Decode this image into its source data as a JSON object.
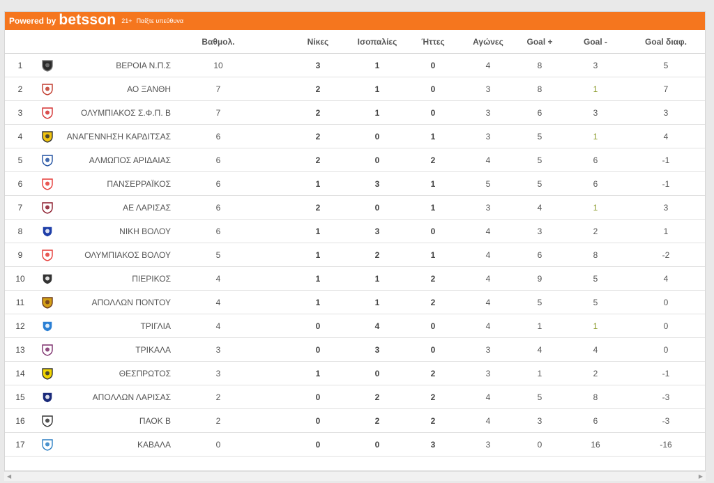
{
  "banner": {
    "powered_by": "Powered by",
    "brand": "betsson",
    "age": "21+",
    "responsible": "Παίξτε υπεύθυνα"
  },
  "colors": {
    "banner": "#f5761e",
    "goal_against_highlight": "#8a9a2a"
  },
  "columns": [
    "Βαθμολ.",
    "Νίκες",
    "Ισοπαλίες",
    "Ήττες",
    "Αγώνες",
    "Goal +",
    "Goal -",
    "Goal διαφ."
  ],
  "rows": [
    {
      "rank": "1",
      "crest": "veroia-crest-icon",
      "team": "ΒΕΡΟΙΑ Ν.Π.Σ",
      "pts": "10",
      "w": "3",
      "d": "1",
      "l": "0",
      "gp": "4",
      "gf": "8",
      "ga": "3",
      "gd": "5",
      "ga_hl": false
    },
    {
      "rank": "2",
      "crest": "xanthi-crest-icon",
      "team": "ΑΟ ΞΑΝΘΗ",
      "pts": "7",
      "w": "2",
      "d": "1",
      "l": "0",
      "gp": "3",
      "gf": "8",
      "ga": "1",
      "gd": "7",
      "ga_hl": true
    },
    {
      "rank": "3",
      "crest": "olympiacos-crest-icon",
      "team": "ΟΛΥΜΠΙΑΚΟΣ Σ.Φ.Π. Β",
      "pts": "7",
      "w": "2",
      "d": "1",
      "l": "0",
      "gp": "3",
      "gf": "6",
      "ga": "3",
      "gd": "3",
      "ga_hl": false
    },
    {
      "rank": "4",
      "crest": "anagennisi-crest-icon",
      "team": "ΑΝΑΓΕΝΝΗΣΗ ΚΑΡΔΙΤΣΑΣ",
      "pts": "6",
      "w": "2",
      "d": "0",
      "l": "1",
      "gp": "3",
      "gf": "5",
      "ga": "1",
      "gd": "4",
      "ga_hl": true
    },
    {
      "rank": "5",
      "crest": "almopos-crest-icon",
      "team": "ΑΛΜΩΠΟΣ ΑΡΙΔΑΙΑΣ",
      "pts": "6",
      "w": "2",
      "d": "0",
      "l": "2",
      "gp": "4",
      "gf": "5",
      "ga": "6",
      "gd": "-1",
      "ga_hl": false
    },
    {
      "rank": "6",
      "crest": "panserraikos-crest-icon",
      "team": "ΠΑΝΣΕΡΡΑΪΚΟΣ",
      "pts": "6",
      "w": "1",
      "d": "3",
      "l": "1",
      "gp": "5",
      "gf": "5",
      "ga": "6",
      "gd": "-1",
      "ga_hl": false
    },
    {
      "rank": "7",
      "crest": "ael-crest-icon",
      "team": "ΑΕ ΛΑΡΙΣΑΣ",
      "pts": "6",
      "w": "2",
      "d": "0",
      "l": "1",
      "gp": "3",
      "gf": "4",
      "ga": "1",
      "gd": "3",
      "ga_hl": true
    },
    {
      "rank": "8",
      "crest": "niki-volou-crest-icon",
      "team": "ΝΙΚΗ ΒΟΛΟΥ",
      "pts": "6",
      "w": "1",
      "d": "3",
      "l": "0",
      "gp": "4",
      "gf": "3",
      "ga": "2",
      "gd": "1",
      "ga_hl": false
    },
    {
      "rank": "9",
      "crest": "olympiakos-volou-crest-icon",
      "team": "ΟΛΥΜΠΙΑΚΟΣ ΒΟΛΟΥ",
      "pts": "5",
      "w": "1",
      "d": "2",
      "l": "1",
      "gp": "4",
      "gf": "6",
      "ga": "8",
      "gd": "-2",
      "ga_hl": false
    },
    {
      "rank": "10",
      "crest": "pierikos-crest-icon",
      "team": "ΠΙΕΡΙΚΟΣ",
      "pts": "4",
      "w": "1",
      "d": "1",
      "l": "2",
      "gp": "4",
      "gf": "9",
      "ga": "5",
      "gd": "4",
      "ga_hl": false
    },
    {
      "rank": "11",
      "crest": "apollon-pontou-crest-icon",
      "team": "ΑΠΟΛΛΩΝ ΠΟΝΤΟΥ",
      "pts": "4",
      "w": "1",
      "d": "1",
      "l": "2",
      "gp": "4",
      "gf": "5",
      "ga": "5",
      "gd": "0",
      "ga_hl": false
    },
    {
      "rank": "12",
      "crest": "triglia-crest-icon",
      "team": "ΤΡΙΓΛΙΑ",
      "pts": "4",
      "w": "0",
      "d": "4",
      "l": "0",
      "gp": "4",
      "gf": "1",
      "ga": "1",
      "gd": "0",
      "ga_hl": true
    },
    {
      "rank": "13",
      "crest": "trikala-crest-icon",
      "team": "ΤΡΙΚΑΛΑ",
      "pts": "3",
      "w": "0",
      "d": "3",
      "l": "0",
      "gp": "3",
      "gf": "4",
      "ga": "4",
      "gd": "0",
      "ga_hl": false
    },
    {
      "rank": "14",
      "crest": "thesprotos-crest-icon",
      "team": "ΘΕΣΠΡΩΤΟΣ",
      "pts": "3",
      "w": "1",
      "d": "0",
      "l": "2",
      "gp": "3",
      "gf": "1",
      "ga": "2",
      "gd": "-1",
      "ga_hl": false
    },
    {
      "rank": "15",
      "crest": "apollon-larisas-crest-icon",
      "team": "ΑΠΟΛΛΩΝ ΛΑΡΙΣΑΣ",
      "pts": "2",
      "w": "0",
      "d": "2",
      "l": "2",
      "gp": "4",
      "gf": "5",
      "ga": "8",
      "gd": "-3",
      "ga_hl": false
    },
    {
      "rank": "16",
      "crest": "paok-b-crest-icon",
      "team": "ΠΑΟΚ Β",
      "pts": "2",
      "w": "0",
      "d": "2",
      "l": "2",
      "gp": "4",
      "gf": "3",
      "ga": "6",
      "gd": "-3",
      "ga_hl": false
    },
    {
      "rank": "17",
      "crest": "kavala-crest-icon",
      "team": "ΚΑΒΑΛΑ",
      "pts": "0",
      "w": "0",
      "d": "0",
      "l": "3",
      "gp": "3",
      "gf": "0",
      "ga": "16",
      "gd": "-16",
      "ga_hl": false
    }
  ]
}
